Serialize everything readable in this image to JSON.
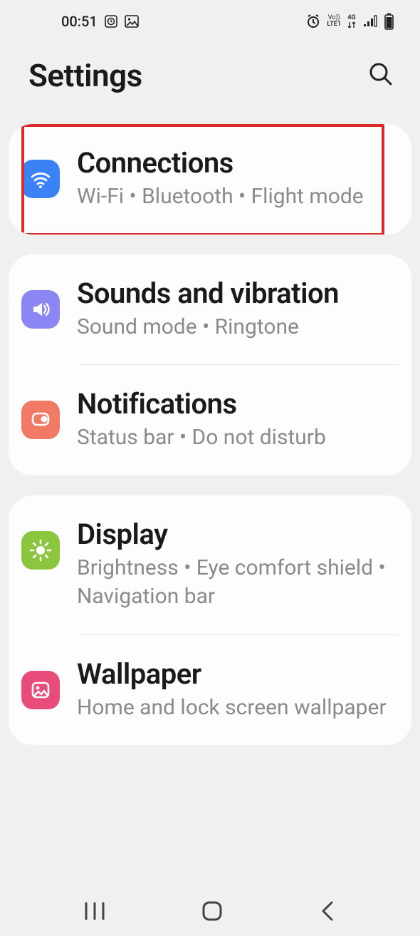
{
  "status": {
    "time": "00:51",
    "net_label1": "Vo))",
    "net_label2": "LTE1",
    "net_label3": "4G"
  },
  "header": {
    "title": "Settings"
  },
  "groups": [
    {
      "highlight": true,
      "items": [
        {
          "icon": "wifi",
          "title": "Connections",
          "sub": "Wi-Fi  •  Bluetooth  •  Flight mode"
        }
      ]
    },
    {
      "items": [
        {
          "icon": "sound",
          "title": "Sounds and vibration",
          "sub": "Sound mode  •  Ringtone"
        },
        {
          "icon": "notif",
          "title": "Notifications",
          "sub": "Status bar  •  Do not disturb"
        }
      ]
    },
    {
      "items": [
        {
          "icon": "display",
          "title": "Display",
          "sub": "Brightness  •  Eye comfort shield  •  Navigation bar"
        },
        {
          "icon": "wall",
          "title": "Wallpaper",
          "sub": "Home and lock screen wallpaper"
        }
      ]
    }
  ]
}
